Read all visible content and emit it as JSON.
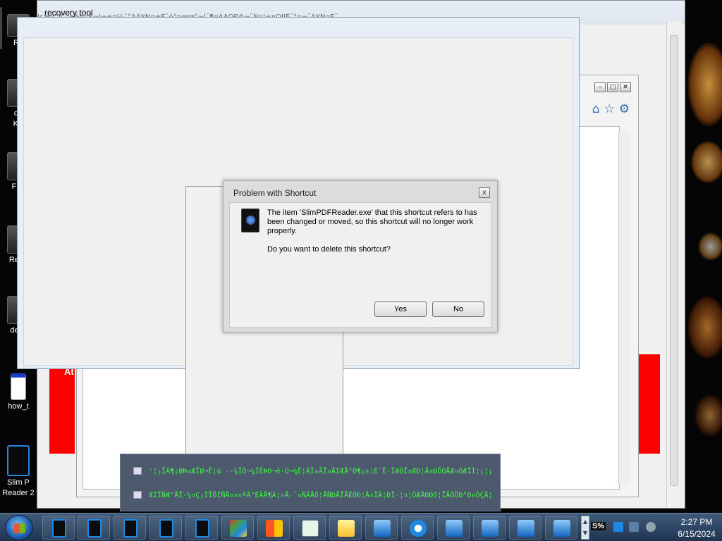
{
  "desktop": {
    "icons": [
      {
        "label": "Re"
      },
      {
        "label": "de"
      },
      {
        "label": "KV"
      },
      {
        "label": "Fire"
      },
      {
        "label": "Read"
      },
      {
        "label": "desk"
      },
      {
        "label": "how_t"
      },
      {
        "label": "Slim P"
      },
      {
        "label": "Reader 2"
      }
    ]
  },
  "back_window": {
    "title": "recovery tool",
    "garbled": "Ìçæ¤°Ã¯¦±ä¤·¦ß¬Ì¬±¤¼¨°ÃÃ¥Ñ¤±Ê¯ó°¤ø¤ø°¬Ì¯¶¤ÃÃÕÐÃ¬¨Ñ¤¦±¤ÓÏÎÈ¯°¤¬¯Ã¥Ñ¤Ê¯"
  },
  "browser_banner": {
    "text": "At"
  },
  "dialog": {
    "title": "Problem with Shortcut",
    "close": "x",
    "message": "The item 'SlimPDFReader.exe' that this shortcut refers to has been changed or moved, so this shortcut will no longer work properly.",
    "question": "Do you want to delete this shortcut?",
    "yes_label": "Yes",
    "no_label": "No"
  },
  "notification": {
    "line1": "'¦¡ÎÀ¶¡ØÞ¤ÆÏØ¬Ê¦ú  -·¼ÎÒ¬¼ÍÈÞÐ¬ê·Ú¬¼Ë¦ÁÎ¤ÃÏ¤ÅÍÆÅ°Ó¶¡±¦È¨Ë·ÎÆÓÏ±ÆÐ¦Å¤ÐÕÓÅÆ¤ÒÆÎÌ¦¡¦¡¦",
    "line2": "ÆÌÏÑÆ°ÅÏ·¼¤Ç¡ÍÎÖÎÑÅ¤¤¤ºÀ°ÉÄÅ¶À¦¤Å·¯¤ÑÃÅÓ¦ÅÑÐÅÎÅÊÒÐ¦Å¤ÎÄ¦ÐÎ·¦¤¦ÔÆÅÐÐÒ¦ÏÅÓÖÐ°Ð¤ÒÇÃ¦¡¦"
  },
  "taskbar": {
    "clock_time": "2:27 PM",
    "clock_date": "6/15/2024",
    "tray_text": "S%"
  },
  "colors": {
    "dialog_bg": "#f0f0f0",
    "notification_text": "#3cff3c",
    "banner_red": "#ff0000",
    "taskbar": "#2b4463"
  }
}
